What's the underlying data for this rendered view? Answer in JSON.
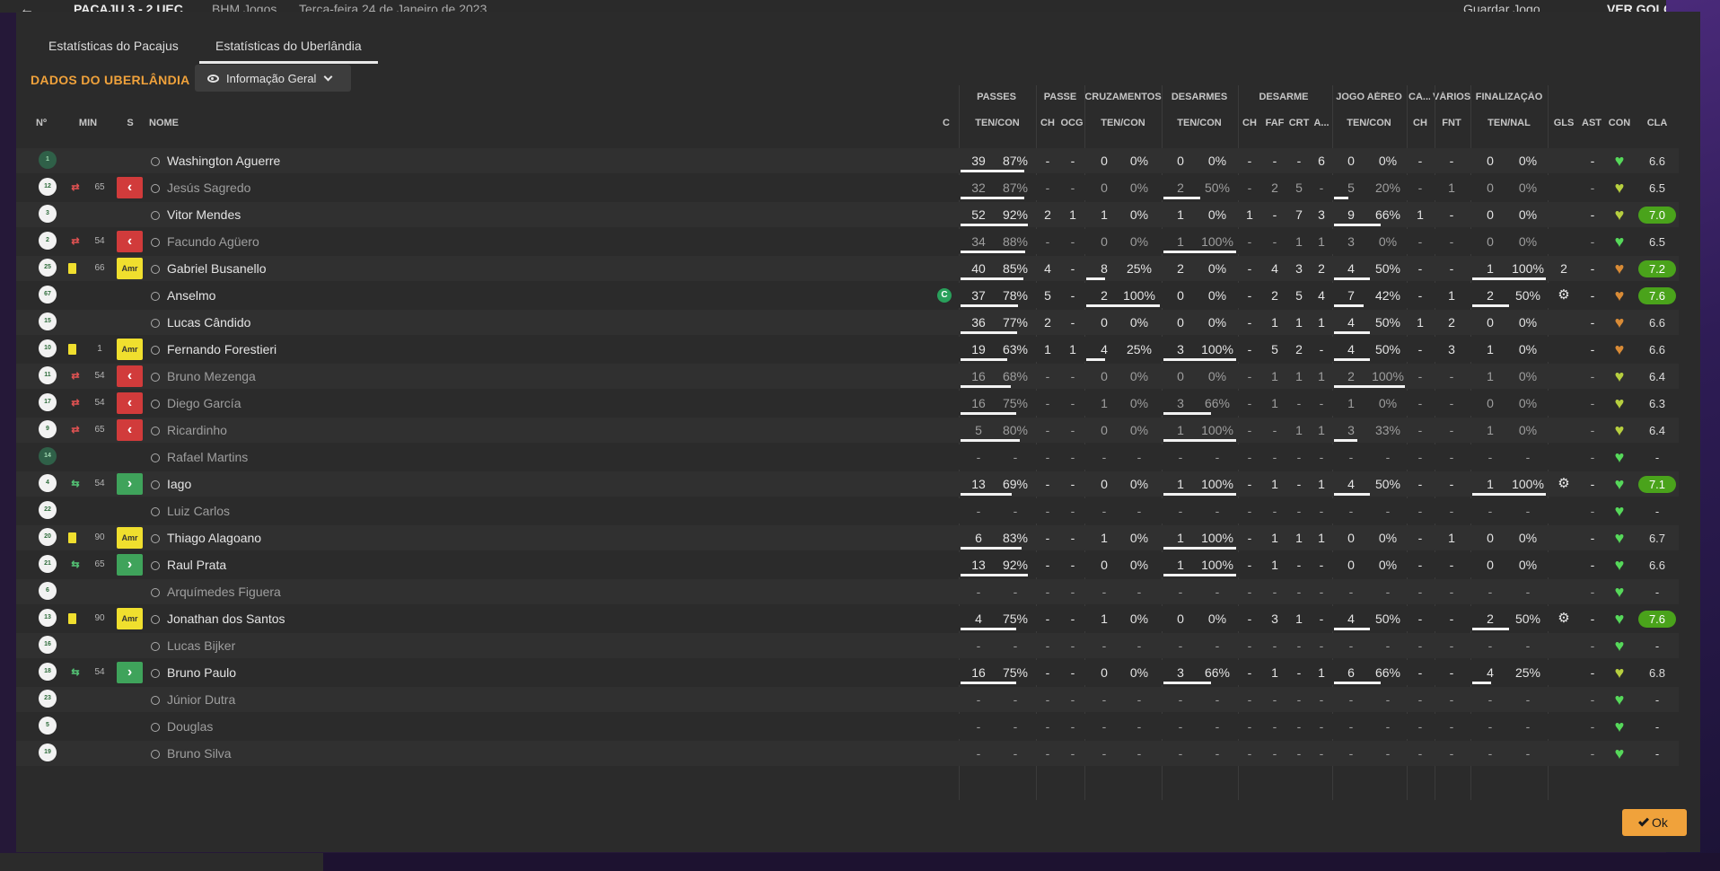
{
  "header": {
    "score_text": "PACAJU 3 - 2 UEC",
    "competition": "BHM Jogos",
    "date": "Terça-feira 24 de Janeiro de 2023",
    "save_label": "Guardar Jogo",
    "goals_label": "VER GOLOS"
  },
  "tabs": [
    {
      "label": "Estatísticas do Pacajus",
      "active": false
    },
    {
      "label": "Estatísticas do Uberlândia",
      "active": true
    }
  ],
  "team_title": "DADOS DO UBERLÂNDIA",
  "view_select": {
    "selected": "Informação Geral"
  },
  "group_headers": [
    "PASSES",
    "PASSE",
    "CRUZAMENTOS",
    "DESARMES",
    "DESARME",
    "JOGO AÉREO",
    "CA...",
    "VÁRIOS",
    "FINALIZAÇÃO"
  ],
  "col_headers": {
    "num": "Nº",
    "min": "MIN",
    "s": "S",
    "name": "NOME",
    "c": "C",
    "passes": "TEN/CON",
    "passe_ch": "CH",
    "passe_ocg": "OCG",
    "cruz": "TEN/CON",
    "desarmes": "TEN/CON",
    "des_ch": "CH",
    "des_faf": "FAF",
    "des_crt": "CRT",
    "des_a": "A...",
    "aereo": "TEN/CON",
    "ca_ch": "CH",
    "varios_fnt": "FNT",
    "finalizacao": "TEN/NAL",
    "gls": "GLS",
    "ast": "AST",
    "con": "CON",
    "cla": "CLA"
  },
  "colors": {
    "accent": "#f0a23b",
    "rating_high": "#4aa31b",
    "sub_out": "#d13b3b",
    "sub_in": "#3fa35b",
    "yellow_card": "#f0df2e"
  },
  "players": [
    {
      "num": "1",
      "gk": true,
      "card": false,
      "sub": "",
      "min": "",
      "badge": "",
      "name": "Washington Aguerre",
      "cap": false,
      "pas": [
        "39",
        "87%"
      ],
      "pch": "-",
      "pocg": "-",
      "cru": [
        "0",
        "0%"
      ],
      "dsm": [
        "0",
        "0%"
      ],
      "dch": "-",
      "dfaf": "-",
      "dcrt": "-",
      "da": "6",
      "aer": [
        "0",
        "0%"
      ],
      "cach": "-",
      "fnt": "-",
      "fin": [
        "0",
        "0%"
      ],
      "gl": "",
      "as": "-",
      "heart": "green",
      "cla": "6.6",
      "hi": false,
      "dim": false,
      "rate": {
        "pas": 0.87,
        "cru": 0,
        "dsm": 0,
        "aer": 0,
        "fin": 0
      }
    },
    {
      "num": "12",
      "gk": false,
      "card": false,
      "sub": "out",
      "min": "65",
      "badge": "out",
      "name": "Jesús Sagredo",
      "cap": false,
      "pas": [
        "32",
        "87%"
      ],
      "pch": "-",
      "pocg": "-",
      "cru": [
        "0",
        "0%"
      ],
      "dsm": [
        "2",
        "50%"
      ],
      "dch": "-",
      "dfaf": "2",
      "dcrt": "5",
      "da": "-",
      "aer": [
        "5",
        "20%"
      ],
      "cach": "-",
      "fnt": "1",
      "fin": [
        "0",
        "0%"
      ],
      "gl": "",
      "as": "-",
      "heart": "yellow",
      "cla": "6.5",
      "hi": false,
      "dim": true,
      "rate": {
        "pas": 0.87,
        "cru": 0,
        "dsm": 0.5,
        "aer": 0.2,
        "fin": 0
      }
    },
    {
      "num": "3",
      "gk": false,
      "card": false,
      "sub": "",
      "min": "",
      "badge": "",
      "name": "Vitor Mendes",
      "cap": false,
      "pas": [
        "52",
        "92%"
      ],
      "pch": "2",
      "pocg": "1",
      "cru": [
        "1",
        "0%"
      ],
      "dsm": [
        "1",
        "0%"
      ],
      "dch": "1",
      "dfaf": "-",
      "dcrt": "7",
      "da": "3",
      "aer": [
        "9",
        "66%"
      ],
      "cach": "1",
      "fnt": "-",
      "fin": [
        "0",
        "0%"
      ],
      "gl": "",
      "as": "-",
      "heart": "yellow",
      "cla": "7.0",
      "hi": true,
      "dim": false,
      "rate": {
        "pas": 0.92,
        "cru": 0,
        "dsm": 0,
        "aer": 0.66,
        "fin": 0
      }
    },
    {
      "num": "2",
      "gk": false,
      "card": false,
      "sub": "out",
      "min": "54",
      "badge": "out",
      "name": "Facundo Agüero",
      "cap": false,
      "pas": [
        "34",
        "88%"
      ],
      "pch": "-",
      "pocg": "-",
      "cru": [
        "0",
        "0%"
      ],
      "dsm": [
        "1",
        "100%"
      ],
      "dch": "-",
      "dfaf": "-",
      "dcrt": "1",
      "da": "1",
      "aer": [
        "3",
        "0%"
      ],
      "cach": "-",
      "fnt": "-",
      "fin": [
        "0",
        "0%"
      ],
      "gl": "",
      "as": "-",
      "heart": "green",
      "cla": "6.5",
      "hi": false,
      "dim": true,
      "rate": {
        "pas": 0.88,
        "cru": 0,
        "dsm": 1,
        "aer": 0,
        "fin": 0
      }
    },
    {
      "num": "25",
      "gk": false,
      "card": true,
      "sub": "",
      "min": "66",
      "badge": "amr",
      "name": "Gabriel Busanello",
      "cap": false,
      "pas": [
        "40",
        "85%"
      ],
      "pch": "4",
      "pocg": "-",
      "cru": [
        "8",
        "25%"
      ],
      "dsm": [
        "2",
        "0%"
      ],
      "dch": "-",
      "dfaf": "4",
      "dcrt": "3",
      "da": "2",
      "aer": [
        "4",
        "50%"
      ],
      "cach": "-",
      "fnt": "-",
      "fin": [
        "1",
        "100%"
      ],
      "gl": "2",
      "as": "-",
      "heart": "orange",
      "cla": "7.2",
      "hi": true,
      "dim": false,
      "rate": {
        "pas": 0.85,
        "cru": 0.25,
        "dsm": 0,
        "aer": 0.5,
        "fin": 1
      }
    },
    {
      "num": "67",
      "gk": false,
      "card": false,
      "sub": "",
      "min": "",
      "badge": "",
      "name": "Anselmo",
      "cap": true,
      "cap_label": "C",
      "pas": [
        "37",
        "78%"
      ],
      "pch": "5",
      "pocg": "-",
      "cru": [
        "2",
        "100%"
      ],
      "dsm": [
        "0",
        "0%"
      ],
      "dch": "-",
      "dfaf": "2",
      "dcrt": "5",
      "da": "4",
      "aer": [
        "7",
        "42%"
      ],
      "cach": "-",
      "fnt": "1",
      "fin": [
        "2",
        "50%"
      ],
      "gl": "gear",
      "as": "-",
      "heart": "orange",
      "cla": "7.6",
      "hi": true,
      "dim": false,
      "rate": {
        "pas": 0.78,
        "cru": 1,
        "dsm": 0,
        "aer": 0.42,
        "fin": 0.5
      }
    },
    {
      "num": "15",
      "gk": false,
      "card": false,
      "sub": "",
      "min": "",
      "badge": "",
      "name": "Lucas Cândido",
      "cap": false,
      "pas": [
        "36",
        "77%"
      ],
      "pch": "2",
      "pocg": "-",
      "cru": [
        "0",
        "0%"
      ],
      "dsm": [
        "0",
        "0%"
      ],
      "dch": "-",
      "dfaf": "1",
      "dcrt": "1",
      "da": "1",
      "aer": [
        "4",
        "50%"
      ],
      "cach": "1",
      "fnt": "2",
      "fin": [
        "0",
        "0%"
      ],
      "gl": "",
      "as": "-",
      "heart": "orange",
      "cla": "6.6",
      "hi": false,
      "dim": false,
      "rate": {
        "pas": 0.77,
        "cru": 0,
        "dsm": 0,
        "aer": 0.5,
        "fin": 0
      }
    },
    {
      "num": "10",
      "gk": false,
      "card": true,
      "sub": "",
      "min": "1",
      "badge": "amr",
      "name": "Fernando Forestieri",
      "cap": false,
      "pas": [
        "19",
        "63%"
      ],
      "pch": "1",
      "pocg": "1",
      "cru": [
        "4",
        "25%"
      ],
      "dsm": [
        "3",
        "100%"
      ],
      "dch": "-",
      "dfaf": "5",
      "dcrt": "2",
      "da": "-",
      "aer": [
        "4",
        "50%"
      ],
      "cach": "-",
      "fnt": "3",
      "fin": [
        "1",
        "0%"
      ],
      "gl": "",
      "as": "-",
      "heart": "orange",
      "cla": "6.6",
      "hi": false,
      "dim": false,
      "rate": {
        "pas": 0.63,
        "cru": 0.25,
        "dsm": 1,
        "aer": 0.5,
        "fin": 0
      }
    },
    {
      "num": "11",
      "gk": false,
      "card": false,
      "sub": "out",
      "min": "54",
      "badge": "out",
      "name": "Bruno Mezenga",
      "cap": false,
      "pas": [
        "16",
        "68%"
      ],
      "pch": "-",
      "pocg": "-",
      "cru": [
        "0",
        "0%"
      ],
      "dsm": [
        "0",
        "0%"
      ],
      "dch": "-",
      "dfaf": "1",
      "dcrt": "1",
      "da": "1",
      "aer": [
        "2",
        "100%"
      ],
      "cach": "-",
      "fnt": "-",
      "fin": [
        "1",
        "0%"
      ],
      "gl": "",
      "as": "-",
      "heart": "yellow",
      "cla": "6.4",
      "hi": false,
      "dim": true,
      "rate": {
        "pas": 0.68,
        "cru": 0,
        "dsm": 0,
        "aer": 1,
        "fin": 0
      }
    },
    {
      "num": "17",
      "gk": false,
      "card": false,
      "sub": "out",
      "min": "54",
      "badge": "out",
      "name": "Diego García",
      "cap": false,
      "pas": [
        "16",
        "75%"
      ],
      "pch": "-",
      "pocg": "-",
      "cru": [
        "1",
        "0%"
      ],
      "dsm": [
        "3",
        "66%"
      ],
      "dch": "-",
      "dfaf": "1",
      "dcrt": "-",
      "da": "-",
      "aer": [
        "1",
        "0%"
      ],
      "cach": "-",
      "fnt": "-",
      "fin": [
        "0",
        "0%"
      ],
      "gl": "",
      "as": "-",
      "heart": "yellow",
      "cla": "6.3",
      "hi": false,
      "dim": true,
      "rate": {
        "pas": 0.75,
        "cru": 0,
        "dsm": 0.66,
        "aer": 0,
        "fin": 0
      }
    },
    {
      "num": "9",
      "gk": false,
      "card": false,
      "sub": "out",
      "min": "65",
      "badge": "out",
      "name": "Ricardinho",
      "cap": false,
      "pas": [
        "5",
        "80%"
      ],
      "pch": "-",
      "pocg": "-",
      "cru": [
        "0",
        "0%"
      ],
      "dsm": [
        "1",
        "100%"
      ],
      "dch": "-",
      "dfaf": "-",
      "dcrt": "1",
      "da": "1",
      "aer": [
        "3",
        "33%"
      ],
      "cach": "-",
      "fnt": "-",
      "fin": [
        "1",
        "0%"
      ],
      "gl": "",
      "as": "-",
      "heart": "yellow",
      "cla": "6.4",
      "hi": false,
      "dim": true,
      "rate": {
        "pas": 0.8,
        "cru": 0,
        "dsm": 1,
        "aer": 0.33,
        "fin": 0
      }
    },
    {
      "num": "14",
      "gk": true,
      "card": false,
      "sub": "",
      "min": "",
      "badge": "",
      "name": "Rafael Martins",
      "cap": false,
      "pas": [
        "-",
        "-"
      ],
      "pch": "-",
      "pocg": "-",
      "cru": [
        "-",
        "-"
      ],
      "dsm": [
        "-",
        "-"
      ],
      "dch": "-",
      "dfaf": "-",
      "dcrt": "-",
      "da": "-",
      "aer": [
        "-",
        "-"
      ],
      "cach": "-",
      "fnt": "-",
      "fin": [
        "-",
        "-"
      ],
      "gl": "",
      "as": "-",
      "heart": "green",
      "cla": "-",
      "hi": false,
      "dim": true,
      "rate": {
        "pas": 0,
        "cru": 0,
        "dsm": 0,
        "aer": 0,
        "fin": 0
      }
    },
    {
      "num": "4",
      "gk": false,
      "card": false,
      "sub": "in",
      "min": "54",
      "badge": "in",
      "name": "Iago",
      "cap": false,
      "pas": [
        "13",
        "69%"
      ],
      "pch": "-",
      "pocg": "-",
      "cru": [
        "0",
        "0%"
      ],
      "dsm": [
        "1",
        "100%"
      ],
      "dch": "-",
      "dfaf": "1",
      "dcrt": "-",
      "da": "1",
      "aer": [
        "4",
        "50%"
      ],
      "cach": "-",
      "fnt": "-",
      "fin": [
        "1",
        "100%"
      ],
      "gl": "gear",
      "as": "-",
      "heart": "green",
      "cla": "7.1",
      "hi": true,
      "dim": false,
      "rate": {
        "pas": 0.69,
        "cru": 0,
        "dsm": 1,
        "aer": 0.5,
        "fin": 1
      }
    },
    {
      "num": "22",
      "gk": false,
      "card": false,
      "sub": "",
      "min": "",
      "badge": "",
      "name": "Luiz Carlos",
      "cap": false,
      "pas": [
        "-",
        "-"
      ],
      "pch": "-",
      "pocg": "-",
      "cru": [
        "-",
        "-"
      ],
      "dsm": [
        "-",
        "-"
      ],
      "dch": "-",
      "dfaf": "-",
      "dcrt": "-",
      "da": "-",
      "aer": [
        "-",
        "-"
      ],
      "cach": "-",
      "fnt": "-",
      "fin": [
        "-",
        "-"
      ],
      "gl": "",
      "as": "-",
      "heart": "green",
      "cla": "-",
      "hi": false,
      "dim": true,
      "rate": {
        "pas": 0,
        "cru": 0,
        "dsm": 0,
        "aer": 0,
        "fin": 0
      }
    },
    {
      "num": "20",
      "gk": false,
      "card": true,
      "sub": "",
      "min": "90",
      "badge": "amr",
      "name": "Thiago Alagoano",
      "cap": false,
      "pas": [
        "6",
        "83%"
      ],
      "pch": "-",
      "pocg": "-",
      "cru": [
        "1",
        "0%"
      ],
      "dsm": [
        "1",
        "100%"
      ],
      "dch": "-",
      "dfaf": "1",
      "dcrt": "1",
      "da": "1",
      "aer": [
        "0",
        "0%"
      ],
      "cach": "-",
      "fnt": "1",
      "fin": [
        "0",
        "0%"
      ],
      "gl": "",
      "as": "-",
      "heart": "green",
      "cla": "6.7",
      "hi": false,
      "dim": false,
      "rate": {
        "pas": 0.83,
        "cru": 0,
        "dsm": 1,
        "aer": 0,
        "fin": 0
      }
    },
    {
      "num": "21",
      "gk": false,
      "card": false,
      "sub": "in",
      "min": "65",
      "badge": "in",
      "name": "Raul Prata",
      "cap": false,
      "pas": [
        "13",
        "92%"
      ],
      "pch": "-",
      "pocg": "-",
      "cru": [
        "0",
        "0%"
      ],
      "dsm": [
        "1",
        "100%"
      ],
      "dch": "-",
      "dfaf": "1",
      "dcrt": "-",
      "da": "-",
      "aer": [
        "0",
        "0%"
      ],
      "cach": "-",
      "fnt": "-",
      "fin": [
        "0",
        "0%"
      ],
      "gl": "",
      "as": "-",
      "heart": "green",
      "cla": "6.6",
      "hi": false,
      "dim": false,
      "rate": {
        "pas": 0.92,
        "cru": 0,
        "dsm": 1,
        "aer": 0,
        "fin": 0
      }
    },
    {
      "num": "6",
      "gk": false,
      "card": false,
      "sub": "",
      "min": "",
      "badge": "",
      "name": "Arquímedes Figuera",
      "cap": false,
      "pas": [
        "-",
        "-"
      ],
      "pch": "-",
      "pocg": "-",
      "cru": [
        "-",
        "-"
      ],
      "dsm": [
        "-",
        "-"
      ],
      "dch": "-",
      "dfaf": "-",
      "dcrt": "-",
      "da": "-",
      "aer": [
        "-",
        "-"
      ],
      "cach": "-",
      "fnt": "-",
      "fin": [
        "-",
        "-"
      ],
      "gl": "",
      "as": "-",
      "heart": "green",
      "cla": "-",
      "hi": false,
      "dim": true,
      "rate": {
        "pas": 0,
        "cru": 0,
        "dsm": 0,
        "aer": 0,
        "fin": 0
      }
    },
    {
      "num": "13",
      "gk": false,
      "card": true,
      "sub": "",
      "min": "90",
      "badge": "amr",
      "name": "Jonathan dos Santos",
      "cap": false,
      "pas": [
        "4",
        "75%"
      ],
      "pch": "-",
      "pocg": "-",
      "cru": [
        "1",
        "0%"
      ],
      "dsm": [
        "0",
        "0%"
      ],
      "dch": "-",
      "dfaf": "3",
      "dcrt": "1",
      "da": "-",
      "aer": [
        "4",
        "50%"
      ],
      "cach": "-",
      "fnt": "-",
      "fin": [
        "2",
        "50%"
      ],
      "gl": "gear",
      "as": "-",
      "heart": "green",
      "cla": "7.6",
      "hi": true,
      "dim": false,
      "rate": {
        "pas": 0.75,
        "cru": 0,
        "dsm": 0,
        "aer": 0.5,
        "fin": 0.5
      }
    },
    {
      "num": "16",
      "gk": false,
      "card": false,
      "sub": "",
      "min": "",
      "badge": "",
      "name": "Lucas Bijker",
      "cap": false,
      "pas": [
        "-",
        "-"
      ],
      "pch": "-",
      "pocg": "-",
      "cru": [
        "-",
        "-"
      ],
      "dsm": [
        "-",
        "-"
      ],
      "dch": "-",
      "dfaf": "-",
      "dcrt": "-",
      "da": "-",
      "aer": [
        "-",
        "-"
      ],
      "cach": "-",
      "fnt": "-",
      "fin": [
        "-",
        "-"
      ],
      "gl": "",
      "as": "-",
      "heart": "green",
      "cla": "-",
      "hi": false,
      "dim": true,
      "rate": {
        "pas": 0,
        "cru": 0,
        "dsm": 0,
        "aer": 0,
        "fin": 0
      }
    },
    {
      "num": "18",
      "gk": false,
      "card": false,
      "sub": "in",
      "min": "54",
      "badge": "in",
      "name": "Bruno Paulo",
      "cap": false,
      "pas": [
        "16",
        "75%"
      ],
      "pch": "-",
      "pocg": "-",
      "cru": [
        "0",
        "0%"
      ],
      "dsm": [
        "3",
        "66%"
      ],
      "dch": "-",
      "dfaf": "1",
      "dcrt": "-",
      "da": "1",
      "aer": [
        "6",
        "66%"
      ],
      "cach": "-",
      "fnt": "-",
      "fin": [
        "4",
        "25%"
      ],
      "gl": "",
      "as": "-",
      "heart": "yellow",
      "cla": "6.8",
      "hi": false,
      "dim": false,
      "rate": {
        "pas": 0.75,
        "cru": 0,
        "dsm": 0.66,
        "aer": 0.66,
        "fin": 0.25
      }
    },
    {
      "num": "23",
      "gk": false,
      "card": false,
      "sub": "",
      "min": "",
      "badge": "",
      "name": "Júnior Dutra",
      "cap": false,
      "pas": [
        "-",
        "-"
      ],
      "pch": "-",
      "pocg": "-",
      "cru": [
        "-",
        "-"
      ],
      "dsm": [
        "-",
        "-"
      ],
      "dch": "-",
      "dfaf": "-",
      "dcrt": "-",
      "da": "-",
      "aer": [
        "-",
        "-"
      ],
      "cach": "-",
      "fnt": "-",
      "fin": [
        "-",
        "-"
      ],
      "gl": "",
      "as": "-",
      "heart": "green",
      "cla": "-",
      "hi": false,
      "dim": true,
      "rate": {
        "pas": 0,
        "cru": 0,
        "dsm": 0,
        "aer": 0,
        "fin": 0
      }
    },
    {
      "num": "5",
      "gk": false,
      "card": false,
      "sub": "",
      "min": "",
      "badge": "",
      "name": "Douglas",
      "cap": false,
      "pas": [
        "-",
        "-"
      ],
      "pch": "-",
      "pocg": "-",
      "cru": [
        "-",
        "-"
      ],
      "dsm": [
        "-",
        "-"
      ],
      "dch": "-",
      "dfaf": "-",
      "dcrt": "-",
      "da": "-",
      "aer": [
        "-",
        "-"
      ],
      "cach": "-",
      "fnt": "-",
      "fin": [
        "-",
        "-"
      ],
      "gl": "",
      "as": "-",
      "heart": "green",
      "cla": "-",
      "hi": false,
      "dim": true,
      "rate": {
        "pas": 0,
        "cru": 0,
        "dsm": 0,
        "aer": 0,
        "fin": 0
      }
    },
    {
      "num": "19",
      "gk": false,
      "card": false,
      "sub": "",
      "min": "",
      "badge": "",
      "name": "Bruno Silva",
      "cap": false,
      "pas": [
        "-",
        "-"
      ],
      "pch": "-",
      "pocg": "-",
      "cru": [
        "-",
        "-"
      ],
      "dsm": [
        "-",
        "-"
      ],
      "dch": "-",
      "dfaf": "-",
      "dcrt": "-",
      "da": "-",
      "aer": [
        "-",
        "-"
      ],
      "cach": "-",
      "fnt": "-",
      "fin": [
        "-",
        "-"
      ],
      "gl": "",
      "as": "-",
      "heart": "green",
      "cla": "-",
      "hi": false,
      "dim": true,
      "rate": {
        "pas": 0,
        "cru": 0,
        "dsm": 0,
        "aer": 0,
        "fin": 0
      }
    }
  ],
  "ok_label": "Ok"
}
